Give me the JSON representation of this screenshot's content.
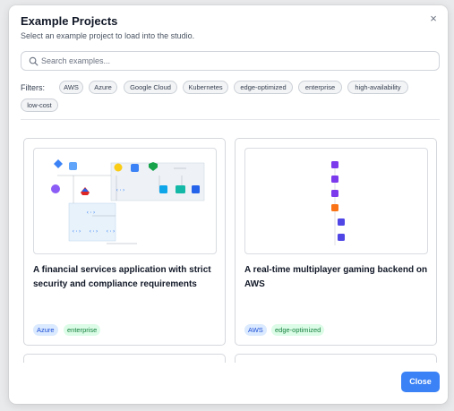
{
  "modal": {
    "title": "Example Projects",
    "subtitle": "Select an example project to load into the studio.",
    "close_icon": "×",
    "close_button_label": "Close"
  },
  "search": {
    "placeholder": "Search examples...",
    "value": ""
  },
  "filters": {
    "label": "Filters:",
    "chips": [
      "AWS",
      "Azure",
      "Google Cloud",
      "Kubernetes",
      "edge-optimized",
      "enterprise",
      "high-availability",
      "low-cost"
    ]
  },
  "projects": [
    {
      "title": "A financial services application with strict security and compliance requirements",
      "tags": [
        "Azure",
        "enterprise"
      ]
    },
    {
      "title": "A real-time multiplayer gaming backend on AWS",
      "tags": [
        "AWS",
        "edge-optimized"
      ]
    }
  ],
  "colors": {
    "accent": "#3b82f6",
    "tag_blue_bg": "#dbeafe",
    "tag_green_bg": "#dcfce7"
  }
}
